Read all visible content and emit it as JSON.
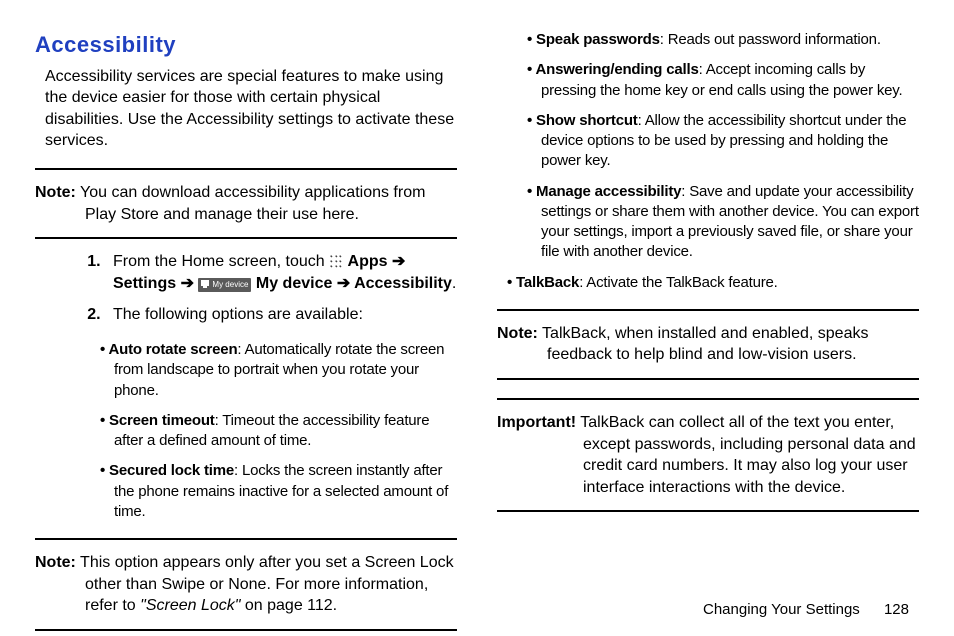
{
  "heading": "Accessibility",
  "intro": "Accessibility services are special features to make using the device easier for those with certain physical disabilities. Use the Accessibility settings to activate these services.",
  "note1": {
    "label": "Note:",
    "text": " You can download accessibility applications from Play Store and manage their use here."
  },
  "step1": {
    "pre": "From the Home screen, touch ",
    "apps": "Apps",
    "arrow1": " ➔ ",
    "settings": "Settings",
    "arrow2": " ➔ ",
    "mydevice_icon_label": "My device",
    "mydevice": " My device",
    "arrow3": " ➔ ",
    "accessibility": "Accessibility",
    "period": "."
  },
  "step2": "The following options are available:",
  "leftBullets": [
    {
      "term": "Auto rotate screen",
      "text": ": Automatically rotate the screen from landscape to portrait when you rotate your phone."
    },
    {
      "term": "Screen timeout",
      "text": ": Timeout the accessibility feature after a defined amount of time."
    },
    {
      "term": "Secured lock time",
      "text": ": Locks the screen instantly after the phone remains inactive for a selected amount of time."
    }
  ],
  "note2": {
    "label": "Note:",
    "text_a": " This option appears only after you set a Screen Lock other than Swipe or None. For more information, refer to ",
    "ref": "\"Screen Lock\"",
    "text_b": " on page 112."
  },
  "rightBullets": [
    {
      "term": "Speak passwords",
      "text": ": Reads out password information."
    },
    {
      "term": "Answering/ending calls",
      "text": ": Accept incoming calls by pressing the home key or end calls using the power key."
    },
    {
      "term": "Show shortcut",
      "text": ": Allow the accessibility shortcut under the device options to be used by pressing and holding the power key."
    },
    {
      "term": "Manage accessibility",
      "text": ": Save and update your accessibility settings or share them with another device. You can export your settings, import a previously saved file, or share your file with another device."
    },
    {
      "term": "TalkBack",
      "text": ": Activate the TalkBack feature."
    }
  ],
  "note3": {
    "label": "Note:",
    "text": " TalkBack, when installed and enabled, speaks feedback to help blind and low-vision users."
  },
  "important": {
    "label": "Important!",
    "text": " TalkBack can collect all of the text you enter, except passwords, including personal data and credit card numbers. It may also log your user interface interactions with the device."
  },
  "footer": {
    "section": "Changing Your Settings",
    "page": "128"
  }
}
